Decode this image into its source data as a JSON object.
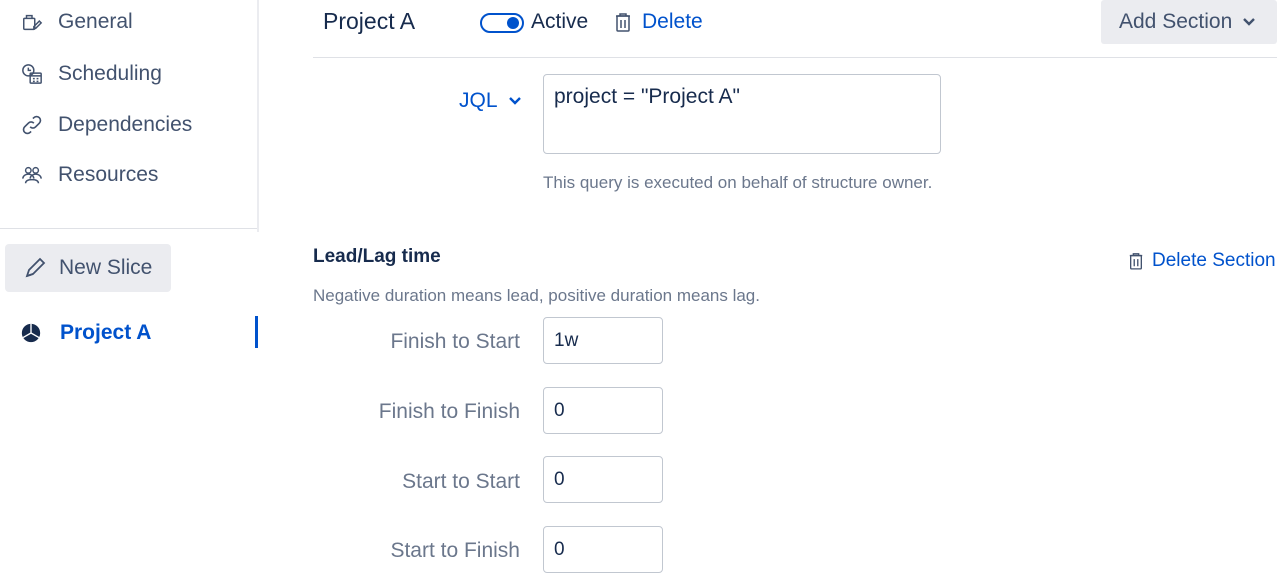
{
  "sidebar": {
    "items": [
      {
        "label": "General",
        "icon": "general-icon"
      },
      {
        "label": "Scheduling",
        "icon": "scheduling-icon"
      },
      {
        "label": "Dependencies",
        "icon": "link-icon"
      },
      {
        "label": "Resources",
        "icon": "resources-icon"
      }
    ],
    "new_slice_label": "New Slice",
    "slices": [
      {
        "label": "Project A",
        "icon": "pie-chart-icon",
        "active": true
      }
    ]
  },
  "header": {
    "title": "Project A",
    "toggle_label": "Active",
    "toggle_on": true,
    "delete_label": "Delete",
    "add_section_label": "Add Section"
  },
  "jql": {
    "mode_label": "JQL",
    "query_value": "project = \"Project A\"",
    "help_text": "This query is executed on behalf of structure owner."
  },
  "lead_lag": {
    "title": "Lead/Lag time",
    "delete_label": "Delete Section",
    "description": "Negative duration means lead, positive duration means lag.",
    "fields": [
      {
        "label": "Finish to Start",
        "value": "1w"
      },
      {
        "label": "Finish to Finish",
        "value": "0"
      },
      {
        "label": "Start to Start",
        "value": "0"
      },
      {
        "label": "Start to Finish",
        "value": "0"
      }
    ]
  },
  "colors": {
    "accent": "#0052cc",
    "text_primary": "#172b4d",
    "text_secondary": "#6b778c",
    "button_bg": "#ebecf0"
  }
}
